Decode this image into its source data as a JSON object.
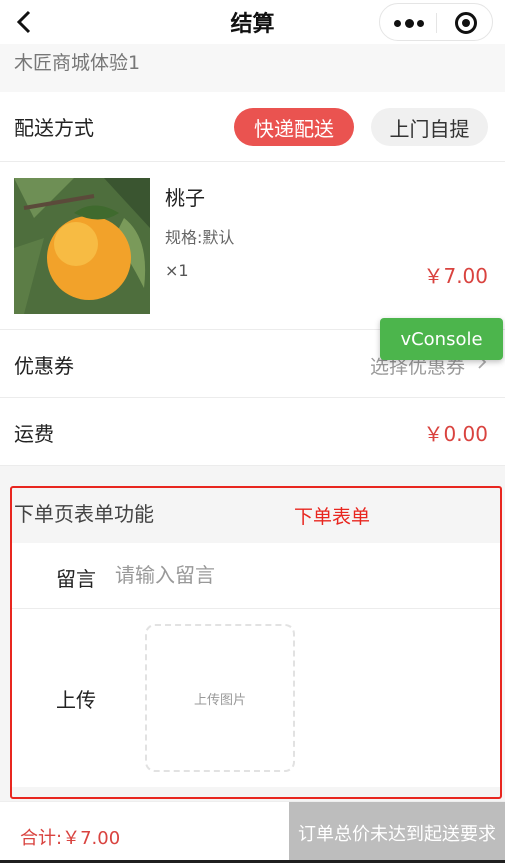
{
  "nav": {
    "title": "结算"
  },
  "address": {
    "text": "木匠商城体验1"
  },
  "delivery": {
    "label": "配送方式",
    "options": [
      "快递配送",
      "上门自提"
    ],
    "selected": "快递配送"
  },
  "product": {
    "name": "桃子",
    "spec": "规格:默认",
    "qty": "×1",
    "price": "￥7.00"
  },
  "coupon": {
    "label": "优惠券",
    "value": "选择优惠券"
  },
  "vconsole": {
    "label": "vConsole"
  },
  "freight": {
    "label": "运费",
    "value": "￥0.00"
  },
  "form": {
    "title": "下单页表单功能",
    "annotation": "下单表单",
    "message_label": "留言",
    "message_placeholder": "请输入留言",
    "upload_label": "上传",
    "upload_hint": "上传图片"
  },
  "footer": {
    "total": "合计:￥7.00",
    "submit": "订单总价未达到起送要求"
  },
  "colors": {
    "accent": "#ea5350",
    "price": "#d9433f",
    "vconsole": "#4cb54c",
    "annotation": "#e8261f"
  }
}
